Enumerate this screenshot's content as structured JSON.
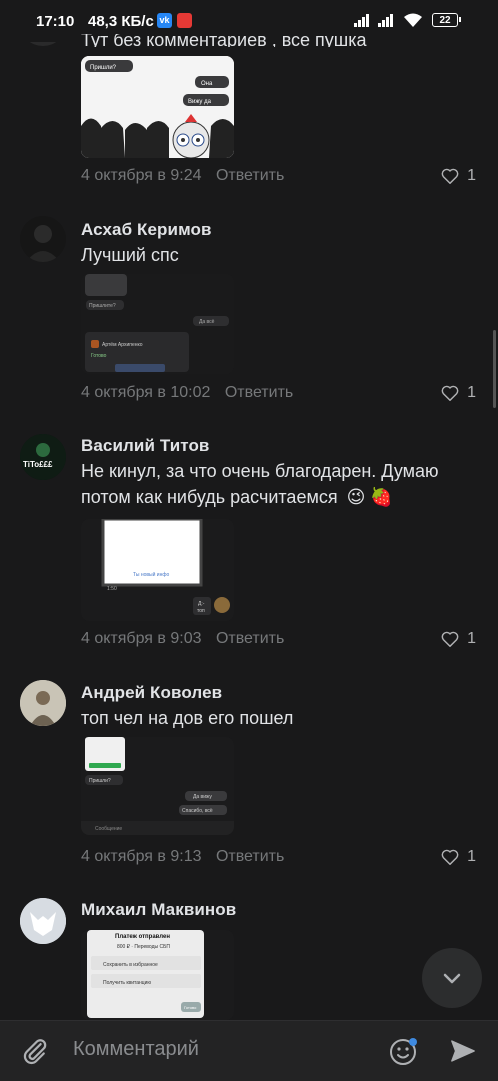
{
  "status": {
    "time": "17:10",
    "net_speed": "48,3 КБ/с",
    "vk_badge": "vk",
    "battery": "22"
  },
  "top_comment": {
    "text": "Тут без комментариев , все пушка",
    "date": "4 октября в 9:24",
    "reply": "Ответить",
    "likes": "1",
    "thumb_texts": [
      "Пришли?",
      "Она",
      "Вижу да"
    ]
  },
  "comments": [
    {
      "author": "Асхаб Керимов",
      "text": "Лучший спс",
      "date": "4 октября в 10:02",
      "reply": "Ответить",
      "likes": "1",
      "thumb_texts": [
        "Пришлите?",
        "Да всё",
        "Артём Архипенко",
        "Готово"
      ]
    },
    {
      "author": "Василий Титов",
      "avatar_text": "TiTo£££",
      "text_line1": "Не кинул, за что очень благодарен. Думаю",
      "text_line2": "потом как нибудь расчитаемся",
      "emoji": [
        "😉",
        "🍓"
      ],
      "date": "4 октября в 9:03",
      "reply": "Ответить",
      "likes": "1",
      "thumb_texts": [
        "Ты новый инфо",
        "1:50",
        "Д:-",
        "топ"
      ]
    },
    {
      "author": "Андрей Коволев",
      "text": "топ чел на дов его пошел",
      "date": "4 октября в 9:13",
      "reply": "Ответить",
      "likes": "1",
      "thumb_texts": [
        "Пришли?",
        "Да вижу",
        "Спасибо, всё",
        "Сообщение"
      ]
    },
    {
      "author": "Михаил Маквинов",
      "thumb_texts": [
        "Платеж отправлен",
        "800 ₽ · Переводы СБП",
        "Сохранить в избранное",
        "Получить квитанцию",
        "Готово"
      ]
    }
  ],
  "composer": {
    "placeholder": "Комментарий"
  },
  "colors": {
    "background": "#19191a",
    "text": "#e1e3e6",
    "secondary": "#76787a"
  }
}
